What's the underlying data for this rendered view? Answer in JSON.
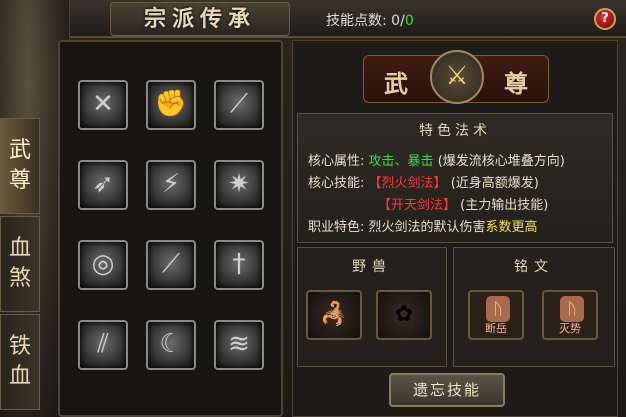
{
  "window": {
    "title": "宗派传承",
    "help_label": "?"
  },
  "points": {
    "label": "技能点数:",
    "current": "0",
    "sep": "/",
    "max": "0"
  },
  "tabs": [
    {
      "label": "武尊",
      "active": true
    },
    {
      "label": "血煞",
      "active": false
    },
    {
      "label": "铁血",
      "active": false
    }
  ],
  "crest": {
    "left": "武",
    "right": "尊",
    "emblem": "⚔"
  },
  "special": {
    "title": "特色法术",
    "attr_label": "核心属性:",
    "attr_value": "攻击、暴击",
    "attr_note": "(爆发流核心堆叠方向)",
    "skill_label": "核心技能:",
    "skill1": "【烈火剑法】",
    "skill1_note": "(近身高额爆发)",
    "skill2": "【开天剑法】",
    "skill2_note": "(主力输出技能)",
    "feature_label": "职业特色:",
    "feature_text": "烈火剑法的默认伤害",
    "feature_highlight": "系数更高"
  },
  "beast": {
    "title": "野兽"
  },
  "rune": {
    "title": "铭文",
    "items": [
      {
        "label": "断岳"
      },
      {
        "label": "灭势"
      }
    ]
  },
  "forget_button": "遗忘技能",
  "skill_icons": [
    "sword-cross",
    "fist",
    "blade-slash",
    "swirl-strike",
    "leaping-figure",
    "pillar-burst",
    "whirlwind",
    "feather-blade",
    "sword-plunge",
    "chain-slash",
    "arc-sweep",
    "spirit-wave"
  ]
}
